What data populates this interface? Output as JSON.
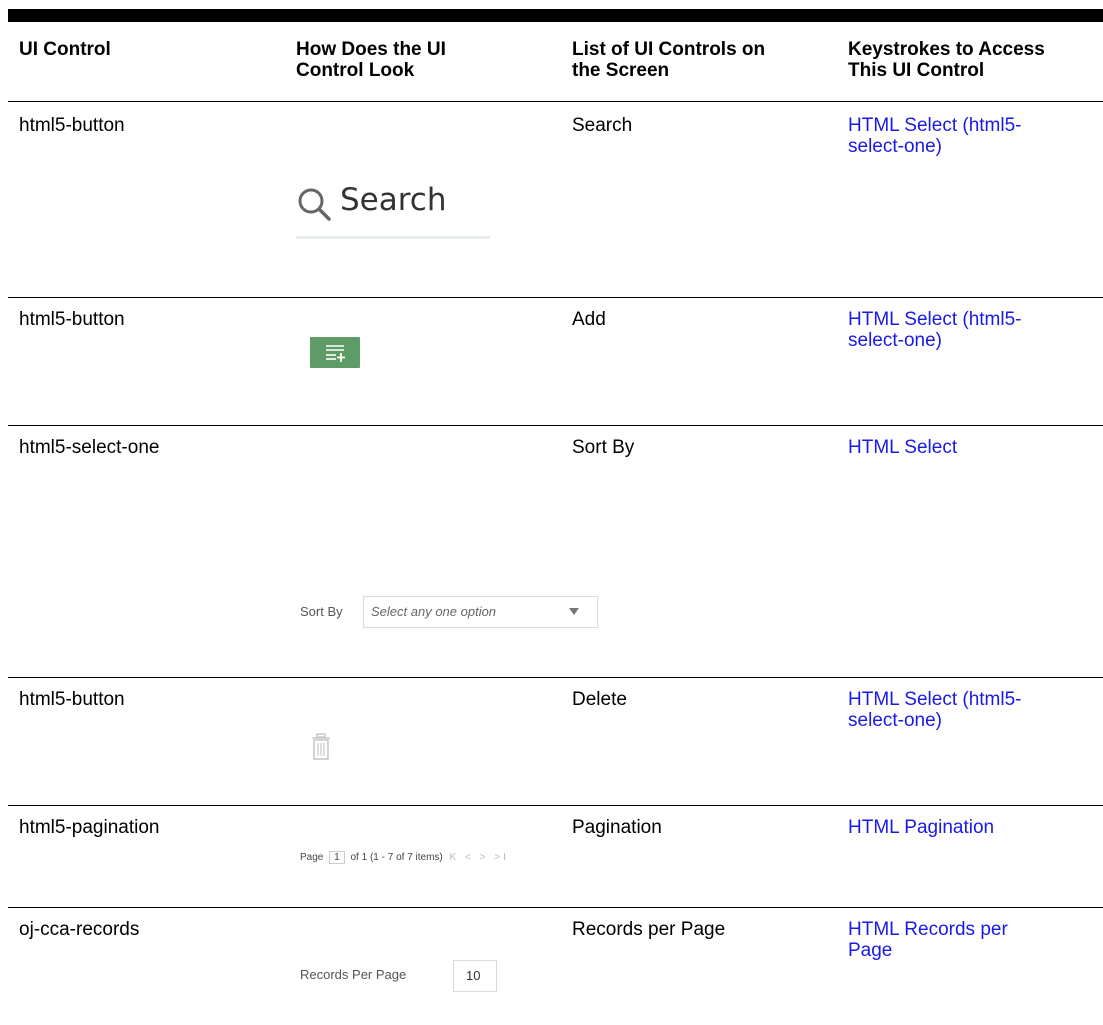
{
  "headers": {
    "col1": "UI Control",
    "col2a": "How Does the UI",
    "col2b": "Control Look",
    "col3a": "List of UI Controls on",
    "col3b": "the Screen",
    "col4a": "Keystrokes to Access",
    "col4b": "This UI Control"
  },
  "rows": [
    {
      "control": "html5-button",
      "screen": "Search",
      "link1": "HTML Select (html5-",
      "link2": "select-one)"
    },
    {
      "control": "html5-button",
      "screen": "Add",
      "link1": "HTML Select (html5-",
      "link2": "select-one)"
    },
    {
      "control": "html5-select-one",
      "screen": "Sort By",
      "link1": "HTML Select",
      "link2": ""
    },
    {
      "control": "html5-button",
      "screen": "Delete",
      "link1": "HTML Select (html5-",
      "link2": "select-one)"
    },
    {
      "control": "html5-pagination",
      "screen": "Pagination",
      "link1": "HTML Pagination",
      "link2": ""
    },
    {
      "control": "oj-cca-records",
      "screen": "Records per Page",
      "link1": "HTML Records per",
      "link2": "Page"
    }
  ],
  "visuals": {
    "search_text": "Search",
    "sort_label": "Sort By",
    "sort_placeholder": "Select any one option",
    "pag_page": "Page",
    "pag_current": "1",
    "pag_of": "of 1",
    "pag_items": "(1 - 7 of  7  items)",
    "pag_nav": "K < > >I",
    "rec_label": "Records Per Page",
    "rec_value": "10"
  },
  "icons": {
    "search": "search-icon",
    "add": "add-list-icon",
    "delete": "trash-icon",
    "dropdown": "chevron-down-icon"
  },
  "colors": {
    "link": "#1a1ae6",
    "add_button": "#5f9b66"
  }
}
